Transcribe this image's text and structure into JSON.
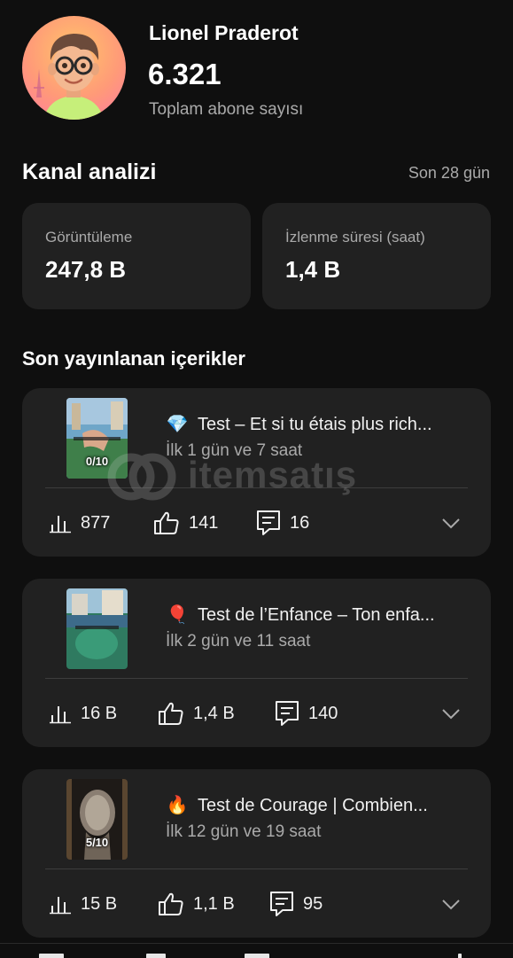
{
  "channel": {
    "name": "Lionel Praderot",
    "subscribers": "6.321",
    "subscribers_label": "Toplam abone sayısı"
  },
  "analytics": {
    "title": "Kanal analizi",
    "period": "Son 28 gün",
    "metrics": [
      {
        "label": "Görüntüleme",
        "value": "247,8 B"
      },
      {
        "label": "İzlenme süresi (saat)",
        "value": "1,4 B"
      }
    ]
  },
  "recent": {
    "title": "Son yayınlanan içerikler",
    "videos": [
      {
        "emoji": "💎",
        "title": "Test – Et si tu étais plus rich...",
        "age": "İlk 1 gün ve 7 saat",
        "thumb_badge": "0/10",
        "views": "877",
        "likes": "141",
        "comments": "16"
      },
      {
        "emoji": "🎈",
        "title": "Test de l’Enfance – Ton enfa...",
        "age": "İlk 2 gün ve 11 saat",
        "thumb_badge": "",
        "views": "16 B",
        "likes": "1,4 B",
        "comments": "140"
      },
      {
        "emoji": "🔥",
        "title": "Test de Courage | Combien...",
        "age": "İlk 12 gün ve 19 saat",
        "thumb_badge": "5/10",
        "views": "15 B",
        "likes": "1,1 B",
        "comments": "95"
      }
    ]
  },
  "watermark": {
    "text": "itemsatış"
  },
  "icons": {
    "views": "bar-chart-icon",
    "likes": "thumbs-up-icon",
    "comments": "comment-icon",
    "expand": "chevron-down-icon"
  },
  "colors": {
    "background": "#0f0f0f",
    "card": "#212121",
    "text_primary": "#ffffff",
    "text_secondary": "#aaaaaa"
  }
}
